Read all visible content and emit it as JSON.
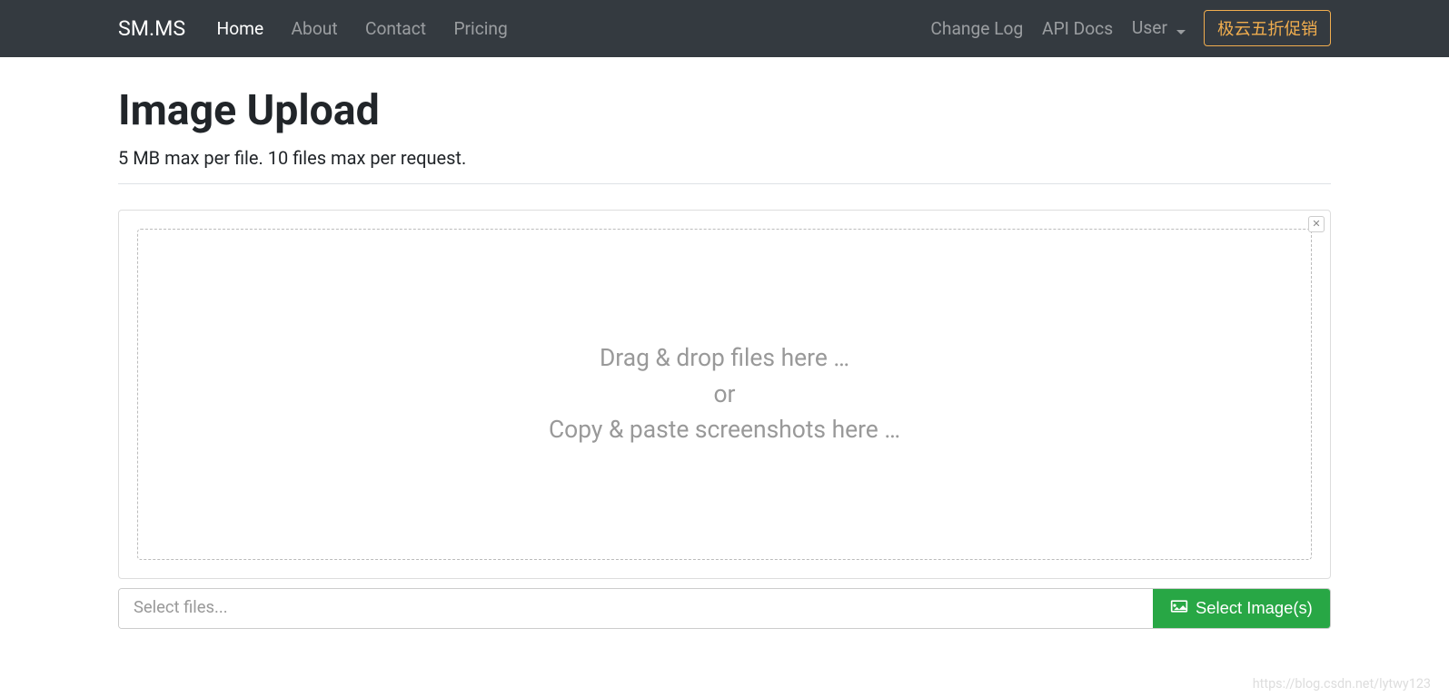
{
  "navbar": {
    "brand": "SM.MS",
    "left": [
      {
        "label": "Home",
        "active": true
      },
      {
        "label": "About",
        "active": false
      },
      {
        "label": "Contact",
        "active": false
      },
      {
        "label": "Pricing",
        "active": false
      }
    ],
    "right": [
      {
        "label": "Change Log"
      },
      {
        "label": "API Docs"
      },
      {
        "label": "User",
        "dropdown": true
      }
    ],
    "promo_label": "极云五折促销"
  },
  "page": {
    "title": "Image Upload",
    "subtitle": "5 MB max per file. 10 files max per request."
  },
  "dropzone": {
    "line1": "Drag & drop files here …",
    "line2": "or",
    "line3": "Copy & paste screenshots here …"
  },
  "file_input": {
    "placeholder": "Select files...",
    "button_label": "Select Image(s)"
  },
  "watermark": "https://blog.csdn.net/lytwy123",
  "colors": {
    "navbar_bg": "#343a40",
    "promo_border": "#f0ad4e",
    "select_btn_bg": "#28a745"
  }
}
